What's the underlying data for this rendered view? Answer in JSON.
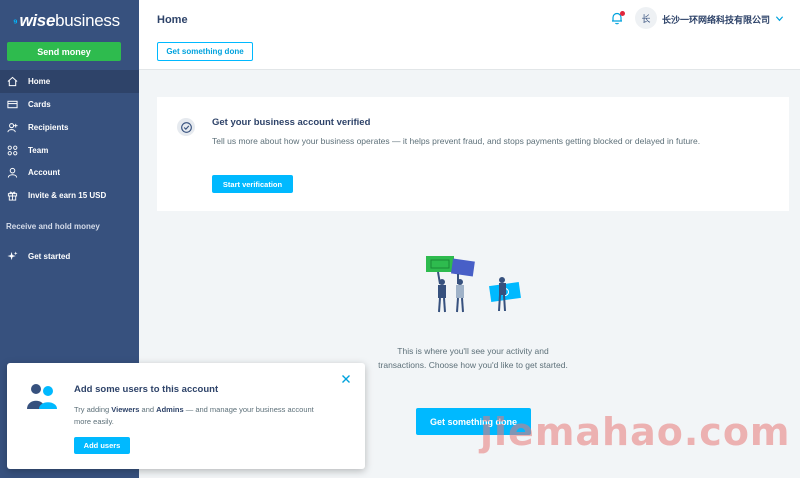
{
  "brand": {
    "logo_flag": "⁹",
    "logo_wise": "wise",
    "logo_business": "business"
  },
  "sidebar": {
    "send_money": "Send money",
    "items": [
      {
        "label": "Home",
        "icon": "home-icon"
      },
      {
        "label": "Cards",
        "icon": "card-icon"
      },
      {
        "label": "Recipients",
        "icon": "recipients-icon"
      },
      {
        "label": "Team",
        "icon": "team-icon"
      },
      {
        "label": "Account",
        "icon": "account-icon"
      },
      {
        "label": "Invite & earn 15 USD",
        "icon": "gift-icon"
      }
    ],
    "section_label": "Receive and hold money",
    "get_started": "Get started"
  },
  "header": {
    "title": "Home",
    "get_something_done": "Get something done",
    "avatar_initial": "长",
    "company": "长沙一环网络科技有限公司"
  },
  "verify": {
    "title": "Get your business account verified",
    "text": "Tell us more about how your business operates — it helps prevent fraud, and stops payments getting blocked or delayed in future.",
    "button": "Start verification"
  },
  "empty_state": {
    "text": "This is where you'll see your activity and transactions. Choose how you'd like to get started.",
    "button": "Get something done"
  },
  "popup": {
    "title": "Add some users to this account",
    "text_before": "Try adding ",
    "viewers": "Viewers",
    "text_and": " and ",
    "admins": "Admins",
    "text_after": " — and manage your business account more easily.",
    "button": "Add users"
  },
  "watermark": "jiemahao.com",
  "colors": {
    "sidebar": "#37517e",
    "accent": "#00b9ff",
    "send_green": "#2ebb4e"
  }
}
